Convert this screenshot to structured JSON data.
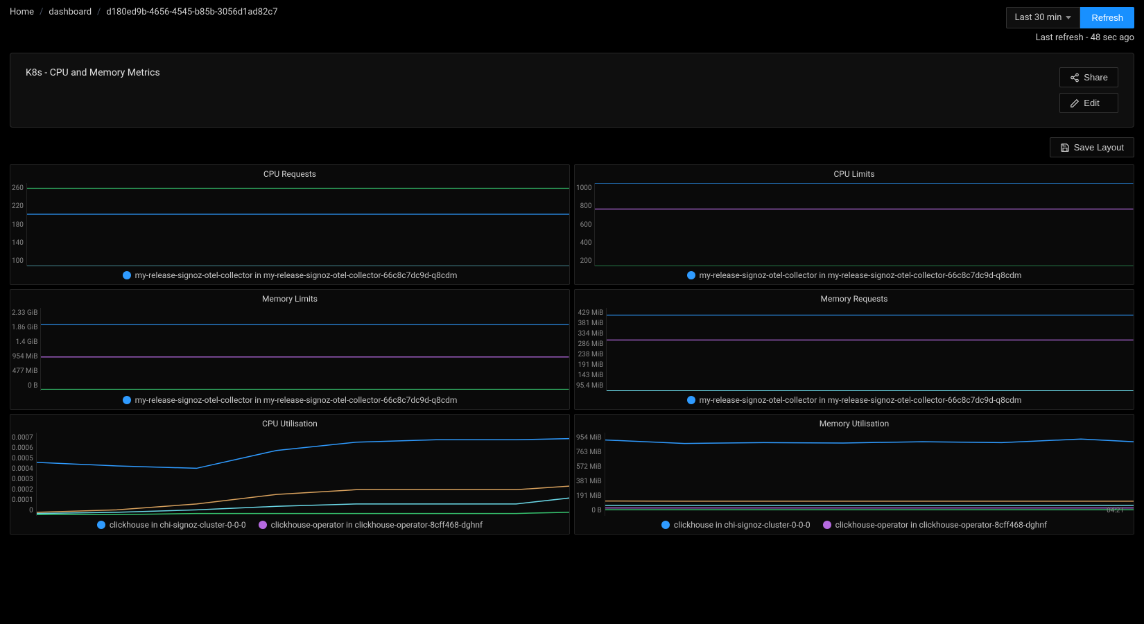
{
  "breadcrumb": [
    {
      "label": "Home",
      "interactive": true
    },
    {
      "label": "dashboard",
      "interactive": true
    },
    {
      "label": "d180ed9b-4656-4545-b85b-3056d1ad82c7",
      "interactive": false
    }
  ],
  "time_picker": "Last 30 min",
  "refresh_label": "Refresh",
  "last_refresh": "Last refresh - 48 sec ago",
  "title": "K8s - CPU and Memory Metrics",
  "share_label": "Share",
  "edit_label": "Edit",
  "save_layout_label": "Save Layout",
  "colors": {
    "blue": "#2f9bff",
    "green": "#36c26e",
    "cyan": "#6bd9e8",
    "magenta": "#b56ae0",
    "orange": "#d9a25e"
  },
  "legend_otel": "my-release-signoz-otel-collector in my-release-signoz-otel-collector-66c8c7dc9d-q8cdm",
  "legend_clickhouse": "clickhouse in chi-signoz-cluster-0-0-0",
  "legend_operator": "clickhouse-operator in clickhouse-operator-8cff468-dghnf",
  "chart_data": [
    {
      "id": "cpu_requests",
      "title": "CPU Requests",
      "type": "line",
      "y_ticks": [
        "260",
        "220",
        "180",
        "140",
        "100"
      ],
      "ylim": [
        100,
        260
      ],
      "series": [
        {
          "name": "green-flat",
          "color": "green",
          "value": 250
        },
        {
          "name": "blue-flat",
          "color": "blue",
          "value": 200
        },
        {
          "name": "cyan-flat",
          "color": "cyan",
          "value": 100
        }
      ],
      "legend": [
        {
          "color": "blue",
          "key": "legend_otel"
        }
      ]
    },
    {
      "id": "cpu_limits",
      "title": "CPU Limits",
      "type": "line",
      "y_ticks": [
        "1000",
        "800",
        "600",
        "400",
        "200"
      ],
      "ylim": [
        200,
        1000
      ],
      "series": [
        {
          "name": "blue-flat",
          "color": "blue",
          "value": 1000
        },
        {
          "name": "magenta-flat",
          "color": "magenta",
          "value": 750
        },
        {
          "name": "green-flat",
          "color": "green",
          "value": 200
        }
      ],
      "legend": [
        {
          "color": "blue",
          "key": "legend_otel"
        }
      ]
    },
    {
      "id": "memory_limits",
      "title": "Memory Limits",
      "type": "line",
      "y_ticks": [
        "2.33 GiB",
        "1.86 GiB",
        "1.4 GiB",
        "954 MiB",
        "477 MiB",
        "0 B"
      ],
      "ylim": [
        0,
        2330
      ],
      "series": [
        {
          "name": "blue-flat",
          "color": "blue",
          "value": 1860
        },
        {
          "name": "magenta-flat",
          "color": "magenta",
          "value": 954
        },
        {
          "name": "green-flat",
          "color": "green",
          "value": 50
        }
      ],
      "legend": [
        {
          "color": "blue",
          "key": "legend_otel"
        }
      ]
    },
    {
      "id": "memory_requests",
      "title": "Memory Requests",
      "type": "line",
      "y_ticks": [
        "429 MiB",
        "381 MiB",
        "334 MiB",
        "286 MiB",
        "238 MiB",
        "191 MiB",
        "143 MiB",
        "95.4 MiB"
      ],
      "ylim": [
        95,
        429
      ],
      "series": [
        {
          "name": "blue-flat",
          "color": "blue",
          "value": 400
        },
        {
          "name": "magenta-flat",
          "color": "magenta",
          "value": 300
        },
        {
          "name": "cyan-flat",
          "color": "cyan",
          "value": 96
        }
      ],
      "legend": [
        {
          "color": "blue",
          "key": "legend_otel"
        }
      ]
    },
    {
      "id": "cpu_util",
      "title": "CPU Utilisation",
      "type": "line",
      "y_ticks": [
        "0.0007",
        "0.0006",
        "0.0005",
        "0.0004",
        "0.0003",
        "0.0002",
        "0.0001",
        "0"
      ],
      "ylim": [
        0,
        0.0007
      ],
      "x": [
        0,
        0.15,
        0.3,
        0.45,
        0.6,
        0.75,
        0.9,
        1.0
      ],
      "series": [
        {
          "name": "blue",
          "color": "blue",
          "values": [
            0.00045,
            0.00042,
            0.0004,
            0.00055,
            0.00062,
            0.00064,
            0.00064,
            0.00065
          ]
        },
        {
          "name": "orange",
          "color": "orange",
          "values": [
            3e-05,
            5e-05,
            0.0001,
            0.00018,
            0.00022,
            0.00022,
            0.00022,
            0.00025
          ]
        },
        {
          "name": "cyan",
          "color": "cyan",
          "values": [
            2e-05,
            3e-05,
            5e-05,
            8e-05,
            0.0001,
            0.0001,
            0.0001,
            0.00015
          ]
        },
        {
          "name": "green",
          "color": "green",
          "values": [
            1e-05,
            1e-05,
            2e-05,
            2e-05,
            2e-05,
            2e-05,
            2e-05,
            3e-05
          ]
        }
      ],
      "legend": [
        {
          "color": "blue",
          "key": "legend_clickhouse"
        },
        {
          "color": "magenta",
          "key": "legend_operator"
        }
      ]
    },
    {
      "id": "memory_util",
      "title": "Memory Utilisation",
      "type": "line",
      "y_ticks": [
        "954 MiB",
        "763 MiB",
        "572 MiB",
        "381 MiB",
        "191 MiB",
        "0 B"
      ],
      "ylim": [
        0,
        954
      ],
      "x": [
        0,
        0.15,
        0.3,
        0.45,
        0.6,
        0.75,
        0.9,
        1.0
      ],
      "x_tick": "04:21",
      "series": [
        {
          "name": "blue",
          "color": "blue",
          "values": [
            870,
            830,
            840,
            835,
            850,
            840,
            880,
            850
          ]
        },
        {
          "name": "orange",
          "color": "orange",
          "values": [
            170,
            168,
            168,
            168,
            168,
            168,
            168,
            168
          ]
        },
        {
          "name": "cyan",
          "color": "cyan",
          "values": [
            120,
            120,
            120,
            120,
            120,
            120,
            120,
            120
          ]
        },
        {
          "name": "magenta",
          "color": "magenta",
          "values": [
            90,
            90,
            90,
            90,
            90,
            90,
            90,
            90
          ]
        },
        {
          "name": "green",
          "color": "green",
          "values": [
            70,
            70,
            70,
            70,
            70,
            70,
            70,
            70
          ]
        }
      ],
      "legend": [
        {
          "color": "blue",
          "key": "legend_clickhouse"
        },
        {
          "color": "magenta",
          "key": "legend_operator"
        }
      ]
    }
  ]
}
